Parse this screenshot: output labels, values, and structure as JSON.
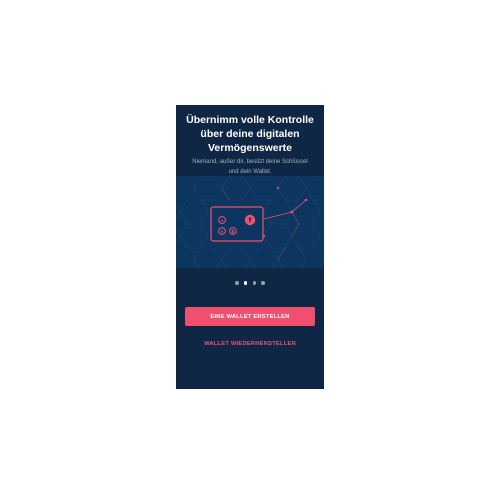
{
  "onboarding": {
    "title": "Übernimm volle Kontrolle\nüber deine digitalen\nVermögenswerte",
    "subtitle": "Niemand, außer dir, besitzt deine Schlüssel\nund dein Wallet.",
    "illustration_icon": "wallet-key-icon",
    "pager": {
      "total": 4,
      "active": 2
    },
    "primary_button_label": "EINE WALLET ERSTELLEN",
    "secondary_button_label": "WALLET WIEDERHERSTELLEN"
  },
  "colors": {
    "background": "#0f2744",
    "illustration_background": "#0c3560",
    "accent": "#f0506e",
    "title_text": "#ffffff",
    "subtitle_text": "#9fb0c4"
  }
}
